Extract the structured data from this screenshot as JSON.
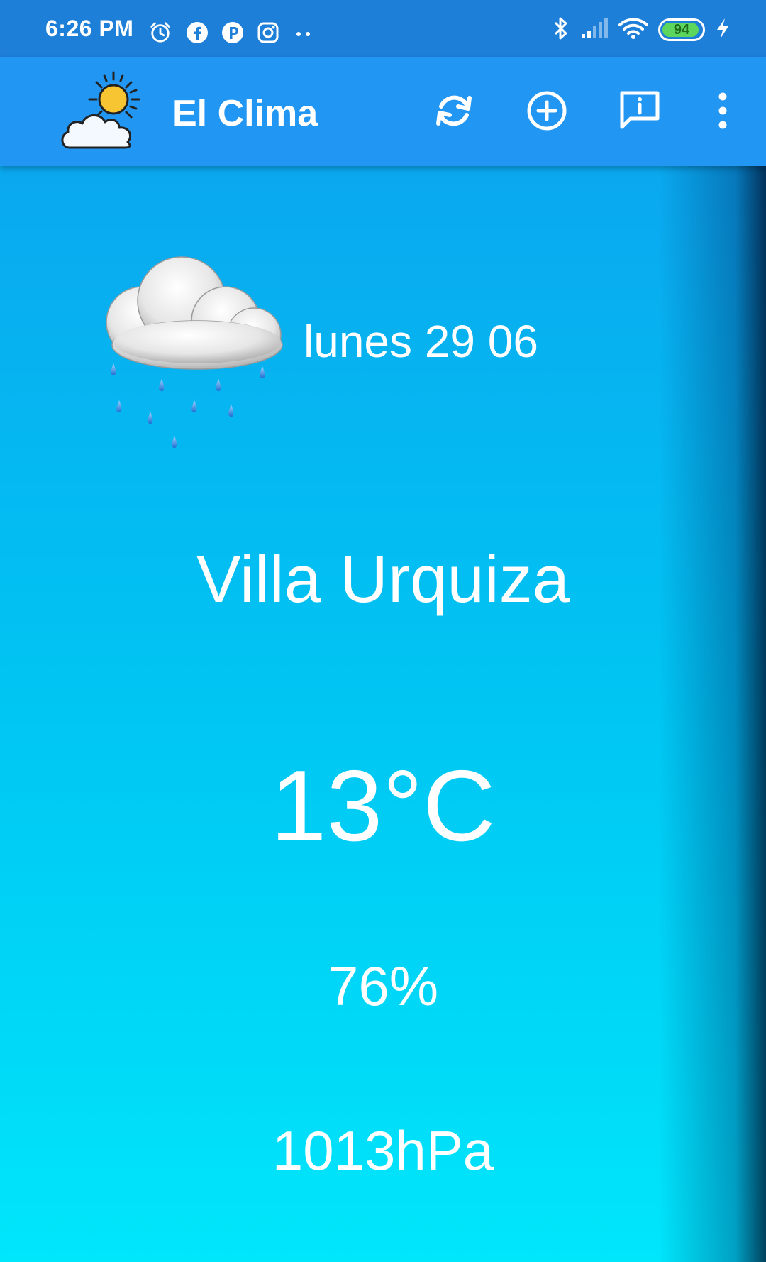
{
  "status_bar": {
    "time": "6:26 PM",
    "battery_level": "94",
    "battery_fraction": 0.94,
    "icons": [
      "alarm-icon",
      "facebook-icon",
      "p-app-icon",
      "instagram-icon",
      "more-dots-icon",
      "bluetooth-icon",
      "signal-icon",
      "wifi-icon",
      "battery-icon",
      "charging-icon"
    ]
  },
  "app_bar": {
    "title": "El Clima",
    "logo": "sun-cloud-logo",
    "actions": [
      "refresh-icon",
      "add-circle-icon",
      "feedback-icon",
      "overflow-menu-icon"
    ],
    "color": "#2196f3"
  },
  "weather": {
    "condition_icon": "rain-cloud-icon",
    "date": "lunes 29 06",
    "location": "Villa Urquiza",
    "temperature": "13°C",
    "humidity": "76%",
    "pressure": "1013hPa"
  }
}
